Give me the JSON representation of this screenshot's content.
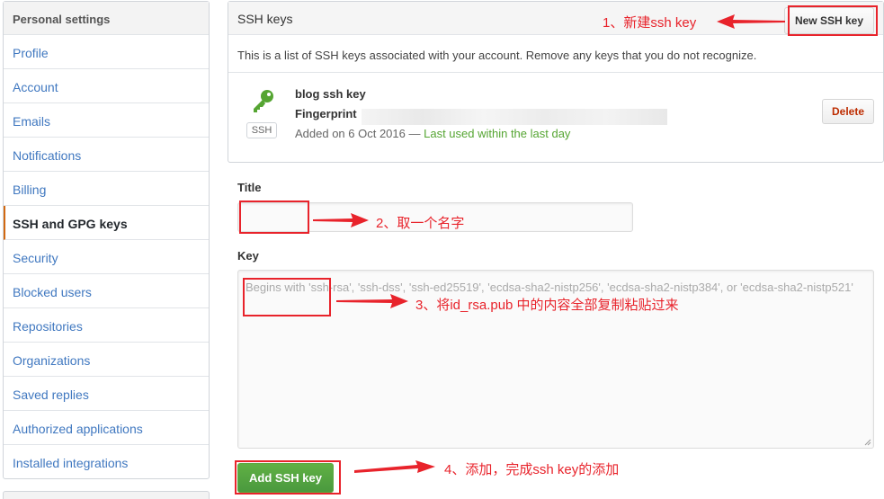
{
  "sidebar": {
    "header": "Personal settings",
    "items": [
      {
        "label": "Profile"
      },
      {
        "label": "Account"
      },
      {
        "label": "Emails"
      },
      {
        "label": "Notifications"
      },
      {
        "label": "Billing"
      },
      {
        "label": "SSH and GPG keys",
        "active": true
      },
      {
        "label": "Security"
      },
      {
        "label": "Blocked users"
      },
      {
        "label": "Repositories"
      },
      {
        "label": "Organizations"
      },
      {
        "label": "Saved replies"
      },
      {
        "label": "Authorized applications"
      },
      {
        "label": "Installed integrations"
      }
    ]
  },
  "ssh_panel": {
    "title": "SSH keys",
    "new_key_label": "New SSH key",
    "description": "This is a list of SSH keys associated with your account. Remove any keys that you do not recognize.",
    "key": {
      "name": "blog ssh key",
      "fingerprint_label": "Fingerprint",
      "badge": "SSH",
      "added_text": "Added on 6 Oct 2016 — ",
      "last_used": "Last used within the last day",
      "delete_label": "Delete"
    }
  },
  "form": {
    "title_label": "Title",
    "title_value": "",
    "key_label": "Key",
    "key_placeholder": "Begins with 'ssh-rsa', 'ssh-dss', 'ssh-ed25519', 'ecdsa-sha2-nistp256', 'ecdsa-sha2-nistp384', or 'ecdsa-sha2-nistp521'",
    "submit_label": "Add SSH key"
  },
  "annotations": {
    "step1": "1、新建ssh key",
    "step2": "2、取一个名字",
    "step3": "3、将id_rsa.pub 中的内容全部复制粘贴过来",
    "step4": "4、添加，完成ssh key的添加"
  },
  "colors": {
    "link": "#4078c0",
    "active_border": "#d26911",
    "annotation_red": "#e8232b",
    "success_green": "#55a532",
    "button_green": "#60b044",
    "danger": "#bd2c00"
  },
  "icons": {
    "key_icon": "key-icon",
    "resize_icon": "resize-grip-icon"
  }
}
